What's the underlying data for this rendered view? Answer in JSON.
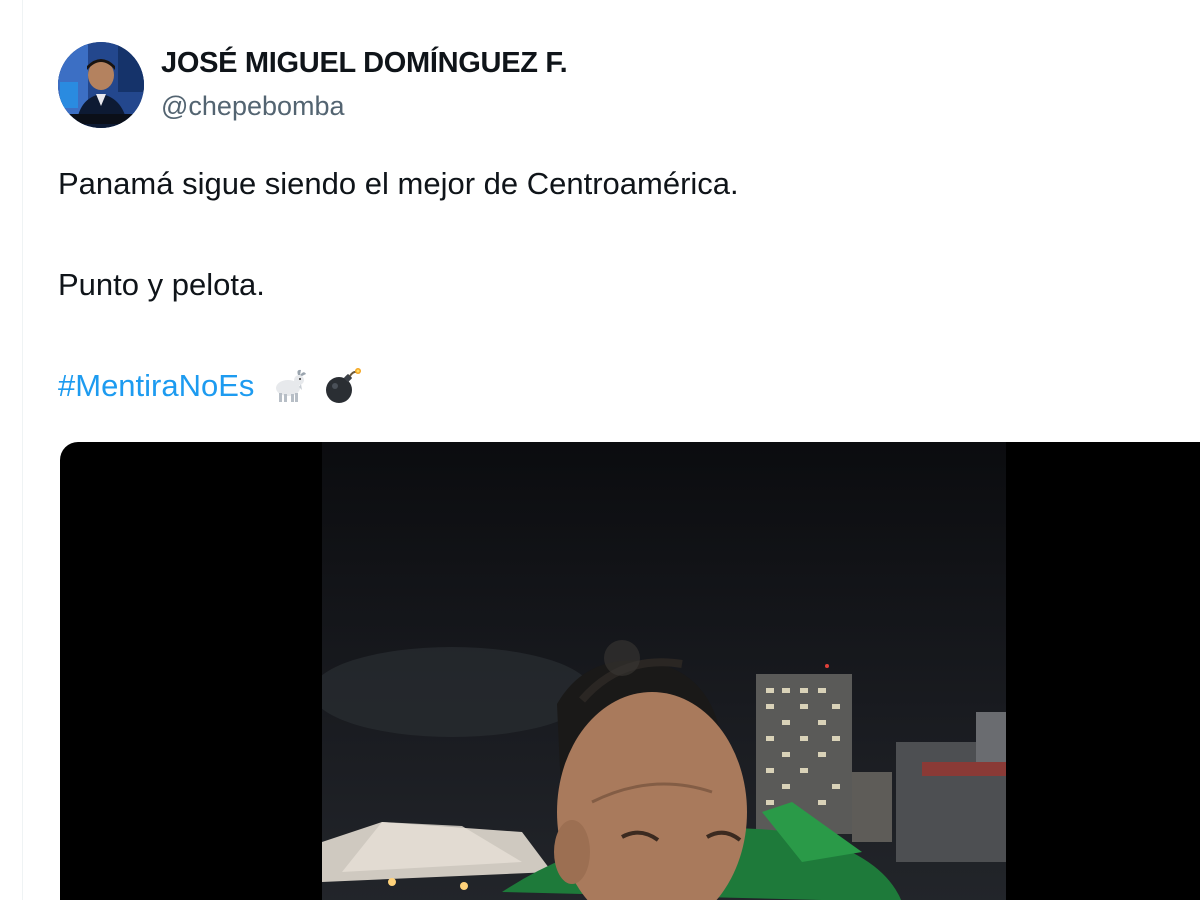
{
  "tweet": {
    "author": {
      "display_name": "JOSÉ MIGUEL DOMÍNGUEZ F.",
      "handle": "@chepebomba"
    },
    "text": {
      "line1": "Panamá sigue siendo el mejor de Centroamérica.",
      "line2": "Punto y pelota.",
      "hashtag": "#MentiraNoEs"
    },
    "emojis": [
      "goat-emoji",
      "bomb-emoji"
    ],
    "colors": {
      "text": "#0f1419",
      "secondary": "#536471",
      "link": "#1d9bf0",
      "media_background": "#000000"
    },
    "media": {
      "type": "video",
      "icon": "video-thumbnail"
    }
  }
}
